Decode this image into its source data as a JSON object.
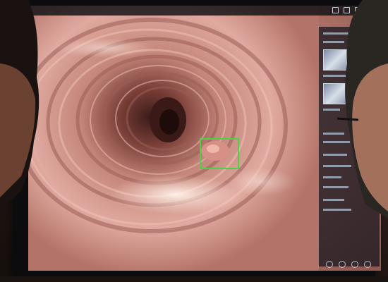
{
  "scene": {
    "subject": "colonoscopy-monitor",
    "colors": {
      "tissue": "#c98a7e",
      "tissue_dark": "#8d5750",
      "detection_box": "#4fd04a",
      "panel": "#12141c"
    }
  },
  "icons": [
    "status-icon",
    "settings-icon",
    "power-icon"
  ]
}
